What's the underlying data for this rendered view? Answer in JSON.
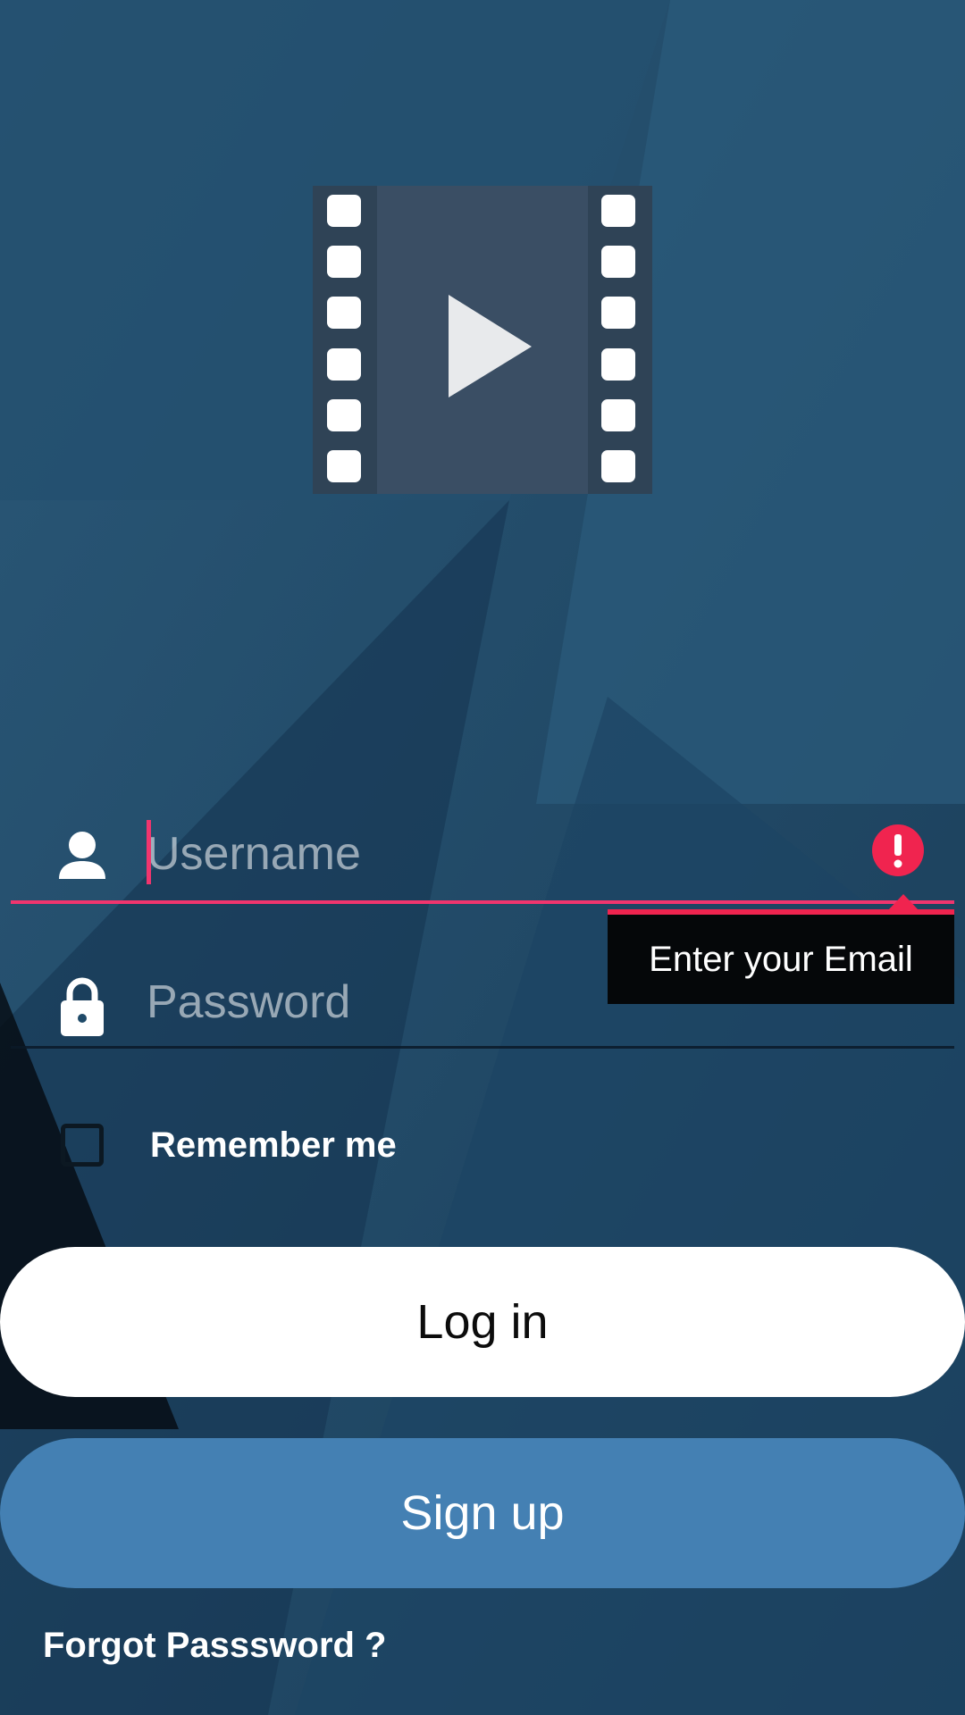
{
  "colors": {
    "background": "#1f4a68",
    "accent_error": "#f0356e",
    "login_button_bg": "#ffffff",
    "signup_button_bg": "#4480b3"
  },
  "logo": {
    "icon": "film-play-icon"
  },
  "username": {
    "placeholder": "Username",
    "value": "",
    "icon": "person-icon"
  },
  "password": {
    "placeholder": "Password",
    "value": "",
    "icon": "lock-icon"
  },
  "error": {
    "icon": "alert-icon",
    "message": "Enter your Email"
  },
  "remember": {
    "label": "Remember me",
    "checked": false
  },
  "buttons": {
    "login": "Log in",
    "signup": "Sign up"
  },
  "forgot": "Forgot Passsword ?"
}
